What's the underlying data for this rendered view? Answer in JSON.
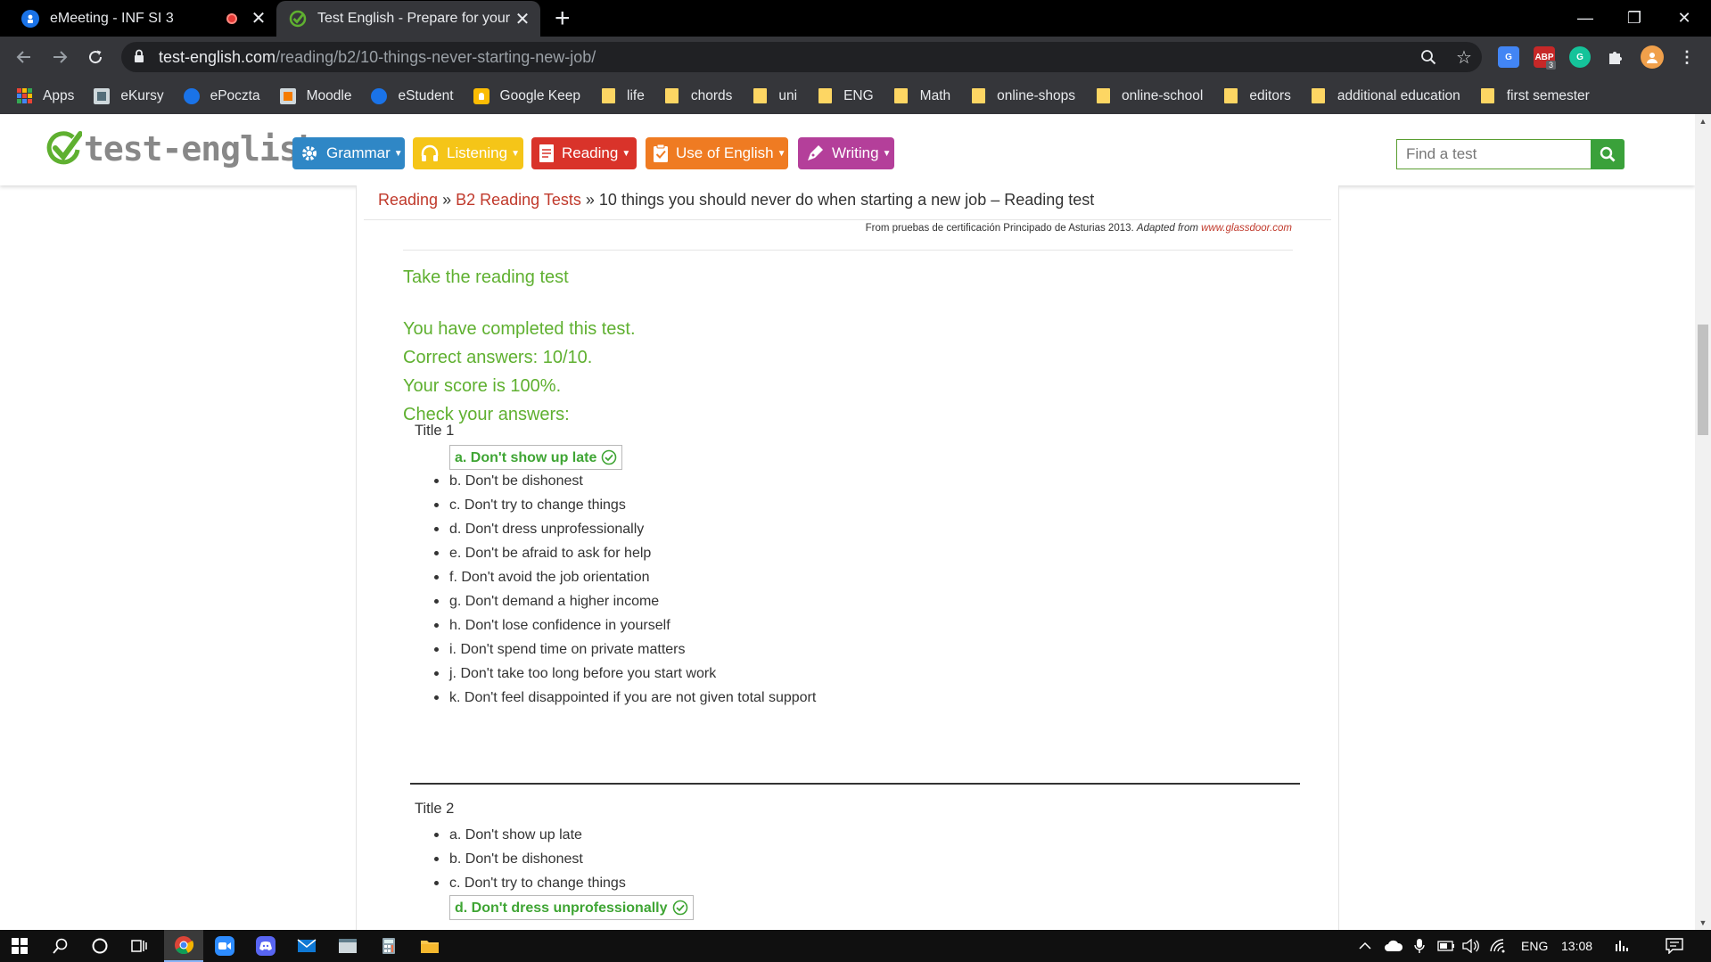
{
  "browser": {
    "tabs": [
      {
        "title": "eMeeting - INF SI 3",
        "active": false,
        "recording": true
      },
      {
        "title": "Test English - Prepare for your En",
        "active": true
      }
    ],
    "new_tab": "+",
    "window_controls": {
      "minimize": "—",
      "restore": "❐",
      "close": "✕"
    },
    "url_host": "test-english.com",
    "url_path": "/reading/b2/10-things-never-starting-new-job/",
    "extensions": {
      "adblock_badge": "3",
      "adblock_label": "ABP"
    }
  },
  "bookmarks": [
    {
      "label": "Apps",
      "icon": "apps-grid-icon"
    },
    {
      "label": "eKursy",
      "icon": "page-icon"
    },
    {
      "label": "ePoczta",
      "icon": "globe-icon"
    },
    {
      "label": "Moodle",
      "icon": "page-icon"
    },
    {
      "label": "eStudent",
      "icon": "globe-icon"
    },
    {
      "label": "Google Keep",
      "icon": "keep-icon"
    },
    {
      "label": "life",
      "icon": "folder-icon"
    },
    {
      "label": "chords",
      "icon": "folder-icon"
    },
    {
      "label": "uni",
      "icon": "folder-icon"
    },
    {
      "label": "ENG",
      "icon": "folder-icon"
    },
    {
      "label": "Math",
      "icon": "folder-icon"
    },
    {
      "label": "online-shops",
      "icon": "folder-icon"
    },
    {
      "label": "online-school",
      "icon": "folder-icon"
    },
    {
      "label": "editors",
      "icon": "folder-icon"
    },
    {
      "label": "additional education",
      "icon": "folder-icon"
    },
    {
      "label": "first semester",
      "icon": "folder-icon"
    }
  ],
  "site": {
    "logo_text": "test-english",
    "menu": [
      {
        "label": "Grammar",
        "color": "#2f87c6",
        "icon": "gear-icon"
      },
      {
        "label": "Listening",
        "color": "#f5c518",
        "icon": "headphones-icon"
      },
      {
        "label": "Reading",
        "color": "#d9332a",
        "icon": "document-icon"
      },
      {
        "label": "Use of English",
        "color": "#ef7b22",
        "icon": "clipboard-check-icon"
      },
      {
        "label": "Writing",
        "color": "#b43f9a",
        "icon": "pen-icon"
      }
    ],
    "search_placeholder": "Find a test"
  },
  "breadcrumb": {
    "level1": "Reading",
    "level2": "B2 Reading Tests",
    "sep": "»",
    "current": "10 things you should never do when starting a new job – Reading test"
  },
  "source": {
    "text": "From pruebas de certificación Principado de Asturias 2013.",
    "adapted": "Adapted from",
    "link": "www.glassdoor.com"
  },
  "result": {
    "heading": "Take the reading test",
    "completed": "You have completed this test.",
    "correct": "Correct answers: 10/10.",
    "score": "Your score is 100%.",
    "check": "Check your answers:"
  },
  "questions": [
    {
      "title": "Title 1",
      "correct_index": 0,
      "options": [
        "a. Don't show up late",
        "b. Don't be dishonest",
        "c. Don't try to change things",
        "d. Don't dress unprofessionally",
        "e. Don't be afraid to ask for help",
        "f. Don't avoid the job orientation",
        "g. Don't demand a higher income",
        "h. Don't lose confidence in yourself",
        "i. Don't spend time on private matters",
        "j. Don't take too long before you start work",
        "k. Don't feel disappointed if you are not given total support"
      ]
    },
    {
      "title": "Title 2",
      "correct_index": 3,
      "options": [
        "a. Don't show up late",
        "b. Don't be dishonest",
        "c. Don't try to change things",
        "d. Don't dress unprofessionally"
      ]
    }
  ],
  "taskbar": {
    "language": "ENG",
    "time": "13:08"
  }
}
